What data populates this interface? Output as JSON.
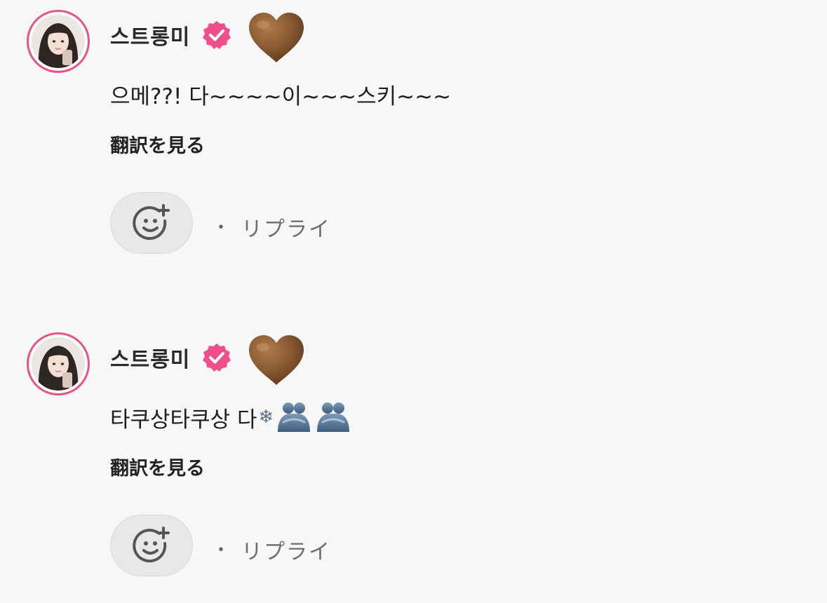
{
  "comments": [
    {
      "username": "스트롱미",
      "text": "으메??! 다~~~~이~~~스키~~~",
      "emojis": [],
      "translate_label": "翻訳を見る",
      "separator": "・",
      "reply_label": "リプライ"
    },
    {
      "username": "스트롱미",
      "text": "타쿠상타쿠상 다",
      "emojis": [
        "❄"
      ],
      "translate_label": "翻訳を見る",
      "separator": "・",
      "reply_label": "リプライ"
    }
  ],
  "colors": {
    "background": "#f7f7f8",
    "avatar_ring": "#e8528a",
    "verified_badge": "#ef4f8b",
    "heart": "#8a5a32",
    "reaction_button_bg": "#e8e8ea"
  },
  "icons": {
    "verified": "verified-badge-icon",
    "heart": "brown-heart-icon",
    "reaction": "add-reaction-icon",
    "hug": "people-hugging-icon"
  }
}
